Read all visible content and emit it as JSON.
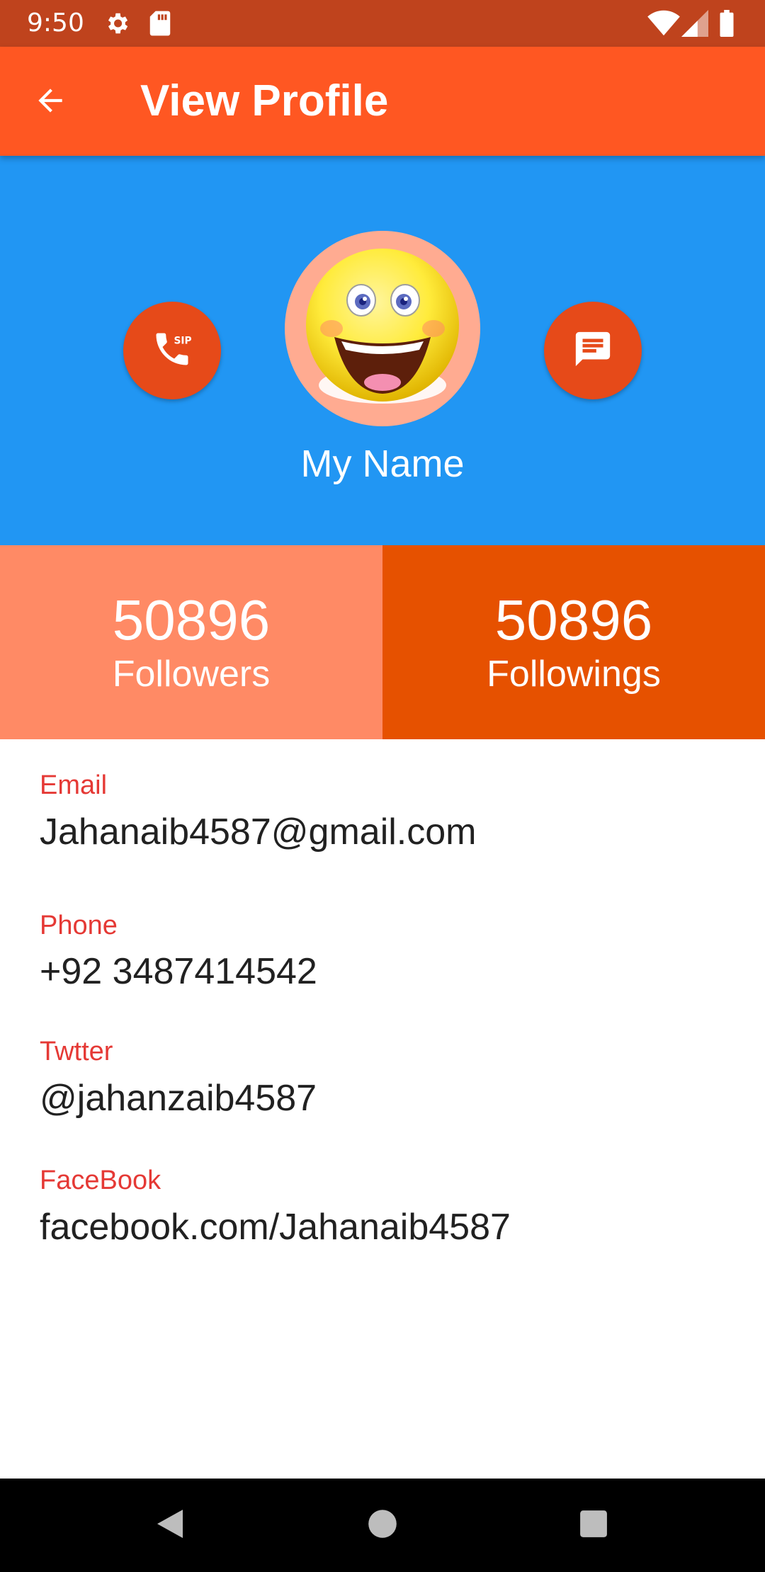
{
  "status_bar": {
    "time": "9:50",
    "icons": [
      "gear-icon",
      "sd-card-icon",
      "wifi-icon",
      "signal-icon",
      "battery-icon"
    ]
  },
  "app_bar": {
    "title": "View Profile",
    "back_icon": "arrow-back-icon"
  },
  "header": {
    "background_color": "#2196F3",
    "name": "My Name",
    "call_button_icon": "sip-call-icon",
    "message_button_icon": "message-icon"
  },
  "stats": {
    "followers": {
      "count": "50896",
      "label": "Followers"
    },
    "followings": {
      "count": "50896",
      "label": "Followings"
    }
  },
  "details": [
    {
      "label": "Email",
      "value": "Jahanaib4587@gmail.com"
    },
    {
      "label": "Phone",
      "value": "+92 3487414542"
    },
    {
      "label": "Twtter",
      "value": "@jahanzaib4587"
    },
    {
      "label": "FaceBook",
      "value": "facebook.com/Jahanaib4587"
    }
  ],
  "colors": {
    "status_bar": "#BF431D",
    "app_bar": "#FF5722",
    "accent_button": "#E64A19",
    "followers_bg": "#FF8A65",
    "followings_bg": "#E65100",
    "label_red": "#E53935"
  },
  "nav_bar": {
    "icons": [
      "back-triangle-icon",
      "home-circle-icon",
      "recents-square-icon"
    ]
  }
}
